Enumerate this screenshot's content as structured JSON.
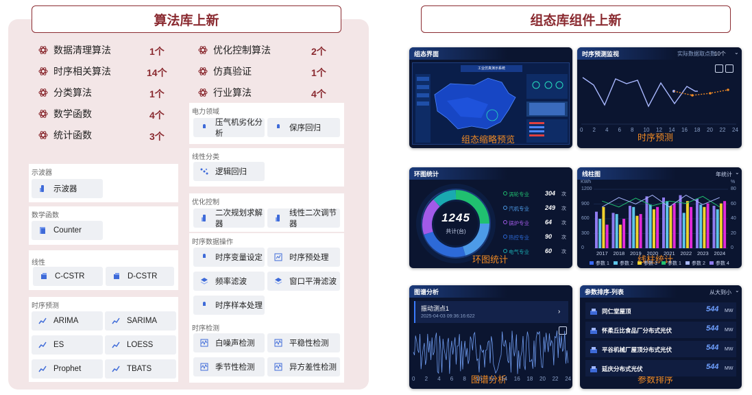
{
  "left": {
    "title": "算法库上新",
    "stats": [
      {
        "label": "数据清理算法",
        "count": "1个"
      },
      {
        "label": "时序相关算法",
        "count": "14个"
      },
      {
        "label": "分类算法",
        "count": "1个"
      },
      {
        "label": "数学函数",
        "count": "4个"
      },
      {
        "label": "统计函数",
        "count": "3个"
      },
      {
        "label": "优化控制算法",
        "count": "2个"
      },
      {
        "label": "仿真验证",
        "count": "1个"
      },
      {
        "label": "行业算法",
        "count": "4个"
      }
    ],
    "cards": {
      "power": {
        "title": "电力领域",
        "items": [
          "压气机劣化分析",
          "保序回归"
        ]
      },
      "linear": {
        "title": "线性分类",
        "items": [
          "逻辑回归"
        ]
      },
      "opt": {
        "title": "优化控制",
        "items": [
          "二次规划求解器",
          "线性二次调节器"
        ]
      },
      "ts_ops": {
        "title": "时序数据操作",
        "items": [
          "时序变量设定",
          "时序预处理",
          "频率滤波",
          "窗口平滑滤波",
          "时序样本处理"
        ]
      },
      "ts_detect": {
        "title": "时序检测",
        "items": [
          "白噪声检测",
          "平稳性检测",
          "季节性检测",
          "异方差性检测"
        ]
      },
      "osc": {
        "title": "示波器",
        "items": [
          "示波器"
        ]
      },
      "math": {
        "title": "数学函数",
        "items": [
          "Counter"
        ]
      },
      "lin": {
        "title": "线性",
        "items": [
          "C-CSTR",
          "D-CSTR"
        ]
      },
      "ts_pred": {
        "title": "时序预测",
        "items": [
          "ARIMA",
          "SARIMA",
          "ES",
          "LOESS",
          "Prophet",
          "TBATS"
        ]
      }
    }
  },
  "right": {
    "title": "组态库组件上新",
    "panels": {
      "p1": {
        "title": "组态界面",
        "caption": "组态缩略预览",
        "inner": "工业仿真演示系统"
      },
      "p2": {
        "title": "时序预测监视",
        "caption": "时序预测",
        "right": "实际数据取点数",
        "sel": "10个",
        "xticks": [
          "0",
          "2",
          "4",
          "6",
          "8",
          "10",
          "12",
          "14",
          "16",
          "18",
          "20",
          "22",
          "24"
        ]
      },
      "p3": {
        "title": "环图统计",
        "caption": "环图统计",
        "big": "1245",
        "sub": "共计(台)",
        "legend": [
          {
            "name": "涡轮专业",
            "val": "304",
            "unit": "次"
          },
          {
            "name": "汽机专业",
            "val": "249",
            "unit": "次"
          },
          {
            "name": "锅炉专业",
            "val": "64",
            "unit": "次"
          },
          {
            "name": "热控专业",
            "val": "90",
            "unit": "次"
          },
          {
            "name": "电气专业",
            "val": "60",
            "unit": "次"
          }
        ]
      },
      "p4": {
        "title": "线柱图",
        "caption": "线柱统计",
        "right": "年统计",
        "yleft": [
          "1200",
          "900",
          "600",
          "300",
          "0"
        ],
        "yright": [
          "80",
          "60",
          "40",
          "20",
          "0"
        ],
        "unitl": "KWh",
        "unitr": "%",
        "years": [
          "2017",
          "2018",
          "2019",
          "2020",
          "2021",
          "2022",
          "2023",
          "2024"
        ],
        "legend": [
          "参数 1",
          "参数 2",
          "参数 3",
          "参数 1",
          "参数 2",
          "参数 4"
        ]
      },
      "p5": {
        "title": "图谱分析",
        "caption": "图谱分析",
        "point": "振动测点1",
        "time": "2025-04-03 09:36:16:622",
        "xticks": [
          "0",
          "2",
          "4",
          "6",
          "8",
          "10",
          "12",
          "14",
          "16",
          "18",
          "20",
          "22",
          "24"
        ]
      },
      "p6": {
        "title": "参数排序-列表",
        "caption": "参数排序",
        "right": "从大到小",
        "items": [
          {
            "name": "同仁堂屋顶",
            "val": "544",
            "unit": "MW"
          },
          {
            "name": "怀柔丘比食品厂分布式光伏",
            "val": "544",
            "unit": "MW"
          },
          {
            "name": "平谷机械厂屋顶分布式光伏",
            "val": "544",
            "unit": "MW"
          },
          {
            "name": "延庆分布式光伏",
            "val": "544",
            "unit": "MW"
          }
        ]
      }
    }
  },
  "colors": {
    "accent": "#8a2a30",
    "panel_bg": "#f3e6e7",
    "dash_bg": "#0b1530",
    "caption": "#f08a24"
  }
}
